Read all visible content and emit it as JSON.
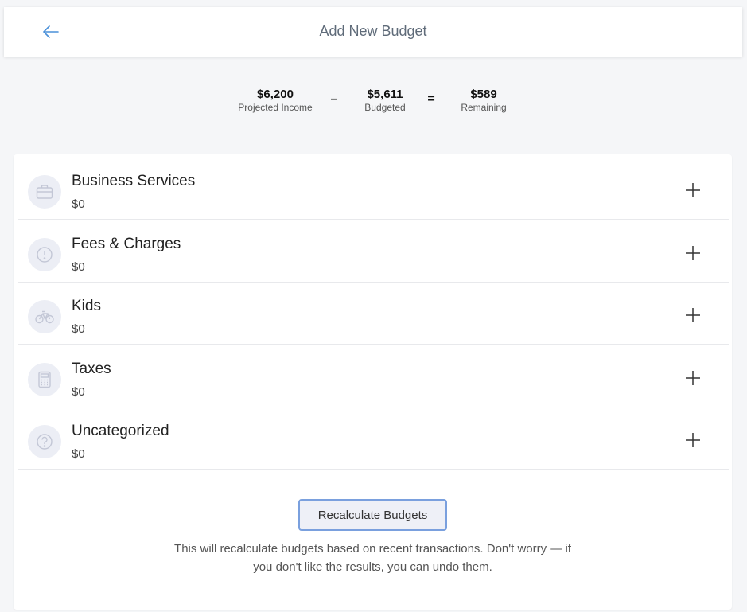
{
  "header": {
    "title": "Add New Budget",
    "back_icon": "arrow-left-icon"
  },
  "summary": {
    "income_value": "$6,200",
    "income_label": "Projected Income",
    "minus_sign": "–",
    "budgeted_value": "$5,611",
    "budgeted_label": "Budgeted",
    "equals_sign": "=",
    "remaining_value": "$589",
    "remaining_label": "Remaining"
  },
  "categories": [
    {
      "name": "Business Services",
      "amount": "$0",
      "icon": "briefcase-icon"
    },
    {
      "name": "Fees & Charges",
      "amount": "$0",
      "icon": "alert-circle-icon"
    },
    {
      "name": "Kids",
      "amount": "$0",
      "icon": "bicycle-icon"
    },
    {
      "name": "Taxes",
      "amount": "$0",
      "icon": "calculator-icon"
    },
    {
      "name": "Uncategorized",
      "amount": "$0",
      "icon": "question-circle-icon"
    }
  ],
  "recalculate": {
    "button_label": "Recalculate Budgets",
    "help_text": "This will recalculate budgets based on recent transactions. Don't worry — if you don't like the results, you can undo them."
  },
  "colors": {
    "accent": "#4a90d9",
    "button_border": "#7aa0de",
    "icon_bg": "#eceef5",
    "icon_fg": "#c7cbd9"
  }
}
